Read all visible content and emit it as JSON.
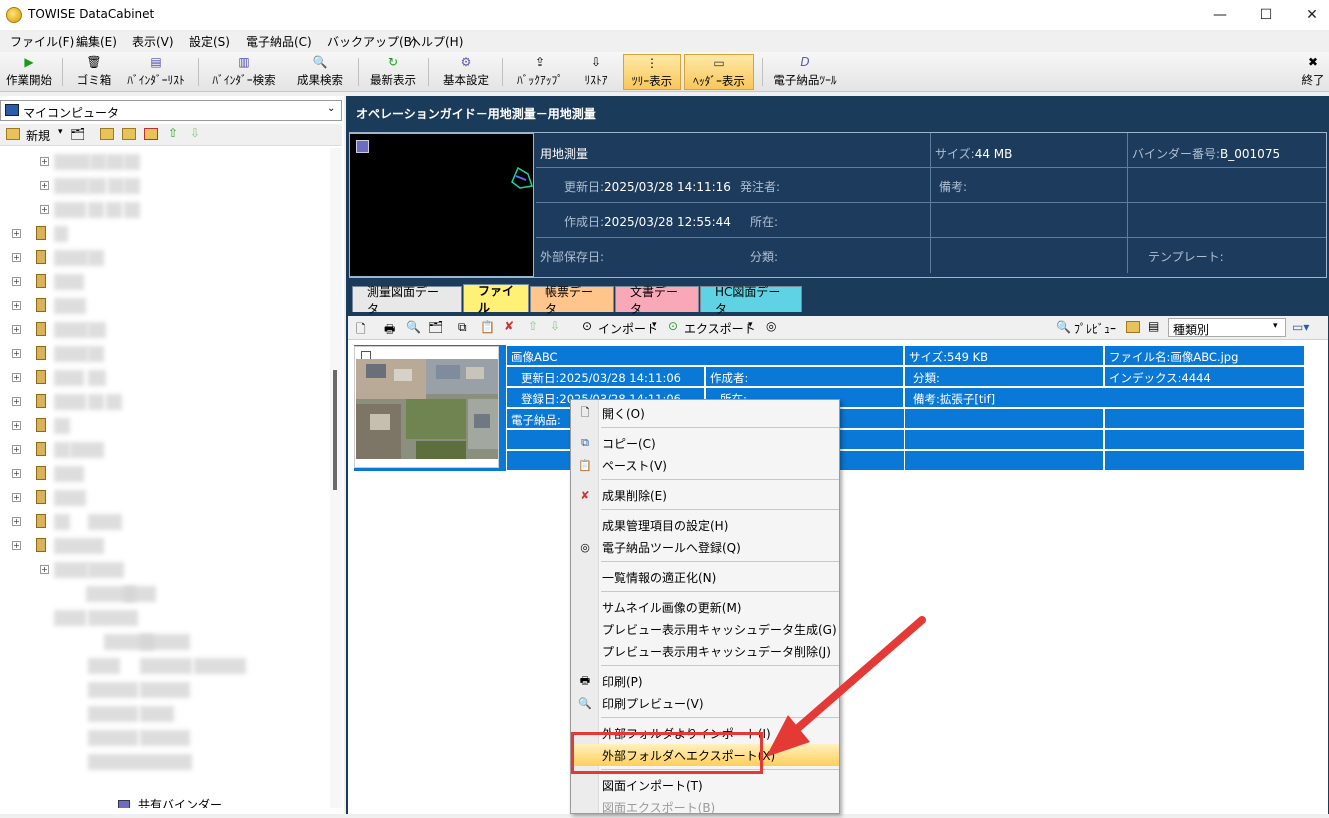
{
  "window": {
    "title": "TOWISE DataCabinet",
    "minimize": "—",
    "maximize": "☐",
    "close": "✕"
  },
  "menu": [
    "ファイル(F)",
    "編集(E)",
    "表示(V)",
    "設定(S)",
    "電子納品(C)",
    "バックアップ(B)",
    "ヘルプ(H)"
  ],
  "toolbar": {
    "start": "作業開始",
    "trash": "ゴミ箱",
    "binder_list": "ﾊﾞｲﾝﾀﾞｰﾘｽﾄ",
    "binder_search": "ﾊﾞｲﾝﾀﾞｰ検索",
    "result_search": "成果検索",
    "latest": "最新表示",
    "settings": "基本設定",
    "backup": "ﾊﾞｯｸｱｯﾌﾟ",
    "restore": "ﾘｽﾄｱ",
    "tree_view": "ﾂﾘｰ表示",
    "header_view": "ﾍｯﾀﾞｰ表示",
    "denshi_tool": "電子納品ﾂｰﾙ",
    "exit": "終了"
  },
  "left": {
    "combo": "マイコンピュータ",
    "new": "新規"
  },
  "header": {
    "path": "オペレーションガイド－用地測量－用地測量"
  },
  "info": {
    "name": "用地測量",
    "size_label": "サイズ:",
    "size": "44 MB",
    "binder_no_label": "バインダー番号:",
    "binder_no": "B_001075",
    "updated_label": "更新日:",
    "updated": "2025/03/28 14:11:16",
    "orderer_label": "発注者:",
    "note_label": "備考:",
    "created_label": "作成日:",
    "created": "2025/03/28 12:55:44",
    "location_label": "所在:",
    "external_label": "外部保存日:",
    "class_label": "分類:",
    "template_label": "テンプレート:"
  },
  "tabs": [
    "測量図面データ",
    "ファイル",
    "帳票データ",
    "文書データ",
    "HC図面データ"
  ],
  "subtoolbar": {
    "import": "インポート",
    "export": "エクスポート",
    "preview": "ﾌﾟﾚﾋﾞｭｰ",
    "sort": "種類別"
  },
  "file": {
    "name": "画像ABC",
    "size": "サイズ:549 KB",
    "filename": "ファイル名:画像ABC.jpg",
    "updated": "更新日:2025/03/28 14:11:06",
    "creator": "作成者:",
    "class": "分類:",
    "index": "インデックス:4444",
    "registered": "登録日:2025/03/28 14:11:06",
    "location": "所在:",
    "note": "備考:拡張子[tif]",
    "denshi": "電子納品:"
  },
  "context_menu": {
    "open": "開く(O)",
    "copy": "コピー(C)",
    "paste": "ペースト(V)",
    "delete": "成果削除(E)",
    "mgmt": "成果管理項目の設定(H)",
    "register": "電子納品ツールへ登録(Q)",
    "normalize": "一覧情報の適正化(N)",
    "thumb_update": "サムネイル画像の更新(M)",
    "cache_gen": "プレビュー表示用キャッシュデータ生成(G)",
    "cache_del": "プレビュー表示用キャッシュデータ削除(J)",
    "print": "印刷(P)",
    "print_preview": "印刷プレビュー(V)",
    "ext_import": "外部フォルダよりインポート(I)",
    "ext_export": "外部フォルダへエクスポート(X)",
    "dwg_import": "図面インポート(T)",
    "dwg_export": "図面エクスポート(B)"
  },
  "tree_bottom": "共有バインダー"
}
